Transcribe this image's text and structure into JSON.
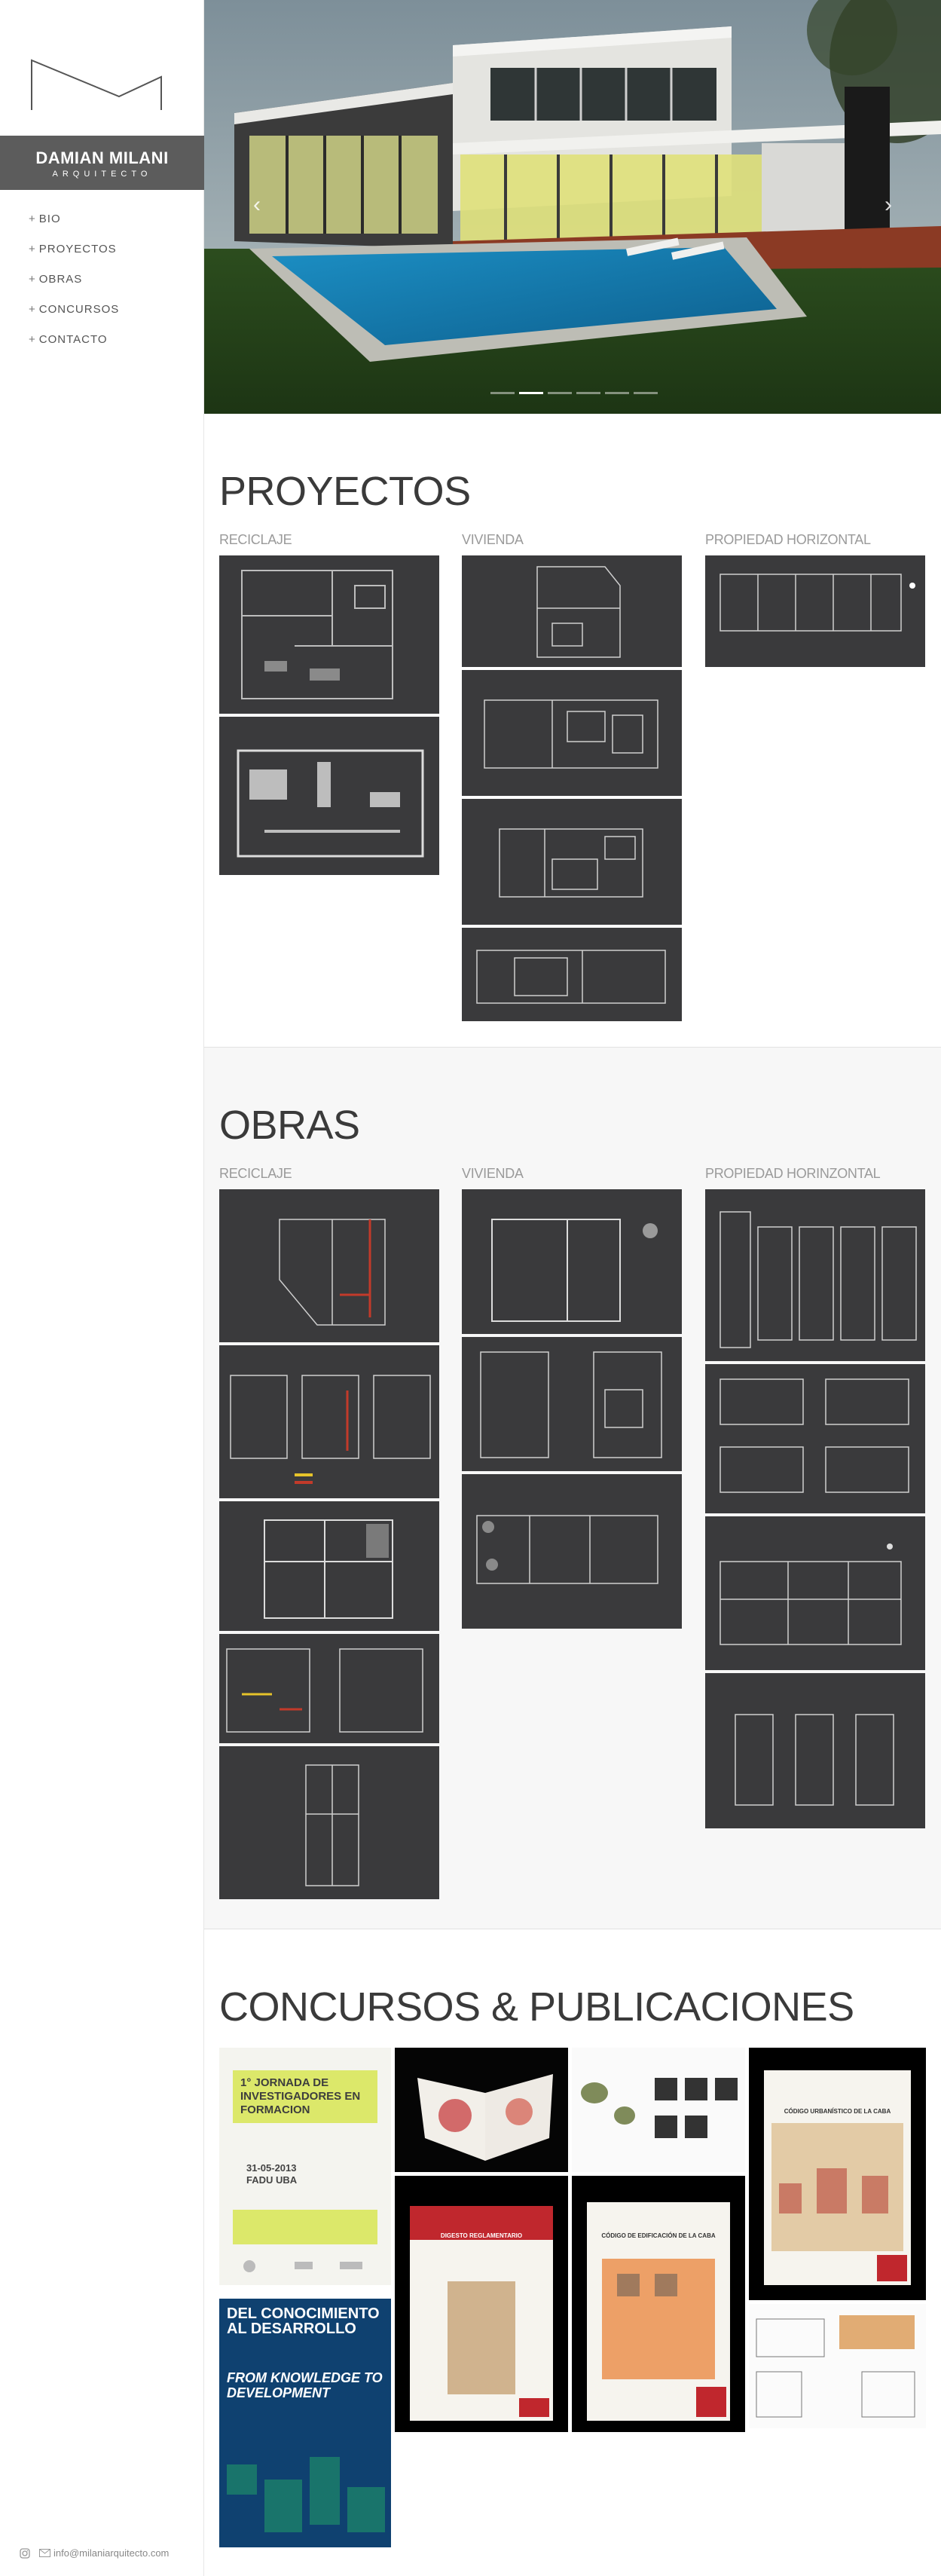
{
  "brand": {
    "name": "DAMIAN MILANI",
    "subtitle": "ARQUITECTO"
  },
  "nav": {
    "prefix": "+",
    "items": [
      "BIO",
      "PROYECTOS",
      "OBRAS",
      "CONCURSOS",
      "CONTACTO"
    ]
  },
  "hero": {
    "prev_icon": "chevron-left-icon",
    "next_icon": "chevron-right-icon",
    "slide_count": 6,
    "active_slide": 2
  },
  "sections": {
    "proyectos": {
      "title": "PROYECTOS",
      "categories": [
        "RECICLAJE",
        "VIVIENDA",
        "PROPIEDAD HORIZONTAL"
      ]
    },
    "obras": {
      "title": "OBRAS",
      "categories": [
        "RECICLAJE",
        "VIVIENDA",
        "PROPIEDAD HORINZONTAL"
      ]
    },
    "concursos": {
      "title": "CONCURSOS & PUBLICACIONES"
    }
  },
  "publications": {
    "poster": {
      "title": "1° JORNADA DE INVESTIGADORES EN FORMACION",
      "date": "31-05-2013",
      "place": "FADU UBA"
    },
    "book_blue": {
      "title_es": "DEL CONOCIMIENTO AL DESARROLLO",
      "title_en": "FROM KNOWLEDGE TO DEVELOPMENT"
    },
    "book_digesto": {
      "title": "DIGESTO REGLAMENTARIO"
    },
    "book_edificacion": {
      "title": "CÓDIGO DE EDIFICACIÓN DE LA CABA"
    },
    "book_urbanistico": {
      "title": "CÓDIGO URBANÍSTICO DE LA CABA"
    }
  },
  "footer": {
    "email": "info@milaniarquitecto.com",
    "icons": [
      "instagram-icon",
      "mail-icon"
    ]
  },
  "colors": {
    "sidebar_band": "#5c5c5c",
    "thumb_bg": "#3a3a3c",
    "poster_accent": "#dce86a",
    "book_red": "#c0272d"
  }
}
